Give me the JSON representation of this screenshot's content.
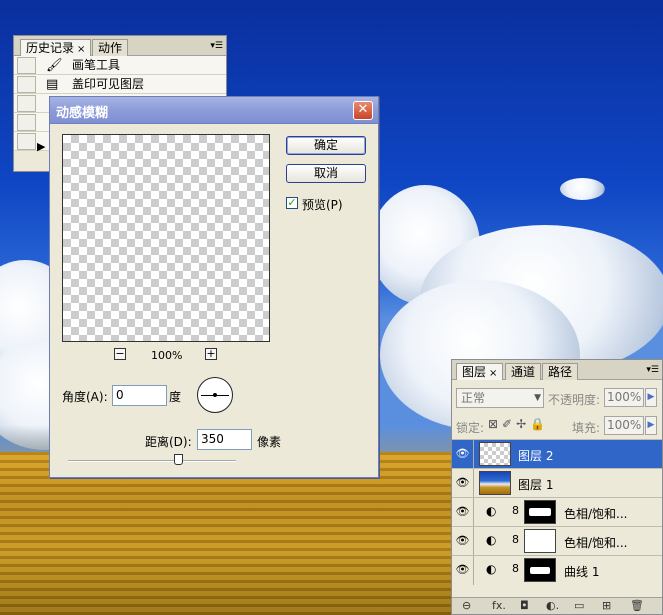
{
  "history_panel": {
    "tabs": [
      {
        "label": "历史记录",
        "close": "×"
      },
      {
        "label": "动作"
      }
    ],
    "menu_glyph": "▾☰",
    "items": [
      {
        "icon": "🖌",
        "label": "画笔工具"
      },
      {
        "icon": "▤",
        "label": "盖印可见图层"
      },
      {
        "icon": "",
        "label": ""
      },
      {
        "icon": "",
        "label": ""
      },
      {
        "icon": "",
        "label": ""
      }
    ],
    "current_marker": "▶"
  },
  "dialog": {
    "title": "动感模糊",
    "close_glyph": "✕",
    "ok_label": "确定",
    "cancel_label": "取消",
    "preview_label": "预览(P)",
    "preview_checked": true,
    "check_glyph": "✓",
    "zoom_out": "−",
    "zoom_in": "+",
    "zoom_value": "100%",
    "angle_label": "角度(A):",
    "angle_value": "0",
    "angle_unit": "度",
    "distance_label": "距离(D):",
    "distance_value": "350",
    "distance_unit": "像素",
    "distance_slider_fraction": 0.35
  },
  "layers_panel": {
    "tabs": [
      {
        "label": "图层",
        "close": "×"
      },
      {
        "label": "通道"
      },
      {
        "label": "路径"
      }
    ],
    "menu_glyph": "▾☰",
    "blend_mode": "正常",
    "opacity_label": "不透明度:",
    "opacity_value": "100%",
    "lock_label": "锁定:",
    "lock_icons": "⊠✐✢🔒",
    "fill_label": "填充:",
    "fill_value": "100%",
    "arrow": "▶",
    "layers": [
      {
        "name": "图层 2",
        "selected": true,
        "type": "pixel",
        "thumb": "transparent"
      },
      {
        "name": "图层 1",
        "selected": false,
        "type": "pixel",
        "thumb": "landscape"
      },
      {
        "name": "色相/饱和...",
        "selected": false,
        "type": "adjustment",
        "thumb": "mask-dark"
      },
      {
        "name": "色相/饱和...",
        "selected": false,
        "type": "adjustment",
        "thumb": "mask-white"
      },
      {
        "name": "曲线 1",
        "selected": false,
        "type": "adjustment",
        "thumb": "mask-dark"
      }
    ],
    "eye_glyph": "👁",
    "adjust_glyph": "◐",
    "link_glyph": "8",
    "bottom_icons": [
      "⊖",
      "fx.",
      "◘",
      "◐.",
      "▭",
      "⊞",
      "🗑"
    ]
  }
}
